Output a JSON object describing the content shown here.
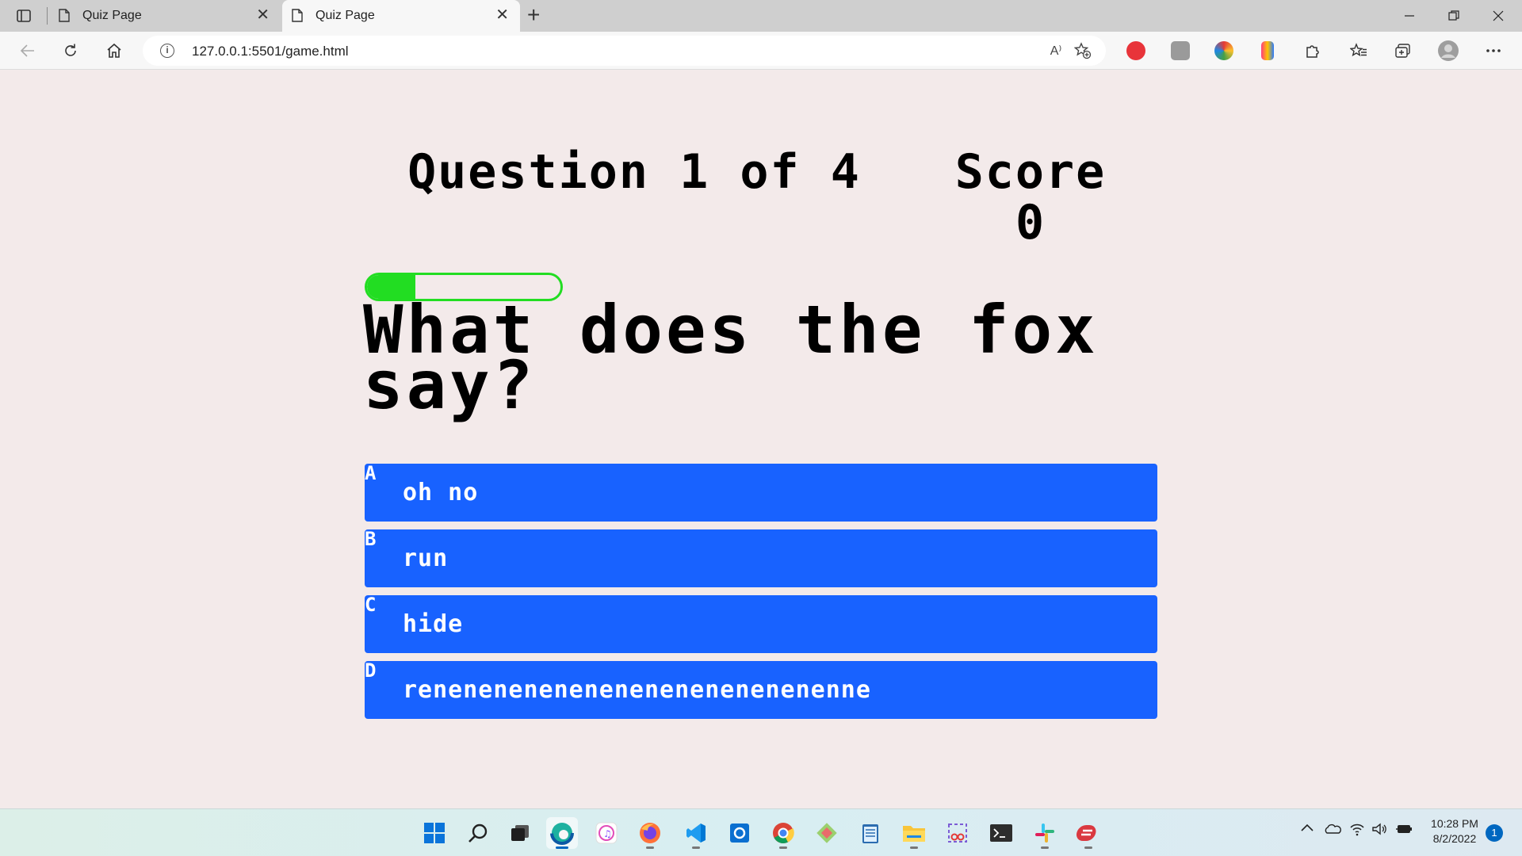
{
  "browser": {
    "tabs": [
      {
        "title": "Quiz Page",
        "active": false
      },
      {
        "title": "Quiz Page",
        "active": true
      }
    ],
    "new_tab_label": "+",
    "close_label": "✕",
    "url": "127.0.0.1:5501/game.html",
    "info_label": "i",
    "read_aloud_label": "A⁾"
  },
  "hud": {
    "question_counter": "Question 1 of 4",
    "score_label": "Score",
    "score_value": "0"
  },
  "progress": {
    "value": 0.25,
    "color": "#22dd22"
  },
  "question": {
    "text": "What does the fox say?"
  },
  "choices": [
    {
      "letter": "A",
      "text": "oh no"
    },
    {
      "letter": "B",
      "text": "run"
    },
    {
      "letter": "C",
      "text": "hide"
    },
    {
      "letter": "D",
      "text": "renenenenenenenenenenenenenenne"
    }
  ],
  "colors": {
    "page_bg": "#f3eaea",
    "choice_bg": "#1862ff",
    "choice_text": "#ffffff"
  },
  "taskbar": {
    "apps": [
      "start-icon",
      "search-icon",
      "task-view-icon",
      "edge-icon",
      "itunes-icon",
      "firefox-icon",
      "vscode-icon",
      "outlook-icon",
      "chrome-icon",
      "git-icon",
      "notepad-icon",
      "file-explorer-icon",
      "snipping-tool-icon",
      "terminal-icon",
      "slack-icon",
      "express-vpn-icon"
    ],
    "time": "10:28 PM",
    "date": "8/2/2022",
    "notification_count": "1"
  }
}
